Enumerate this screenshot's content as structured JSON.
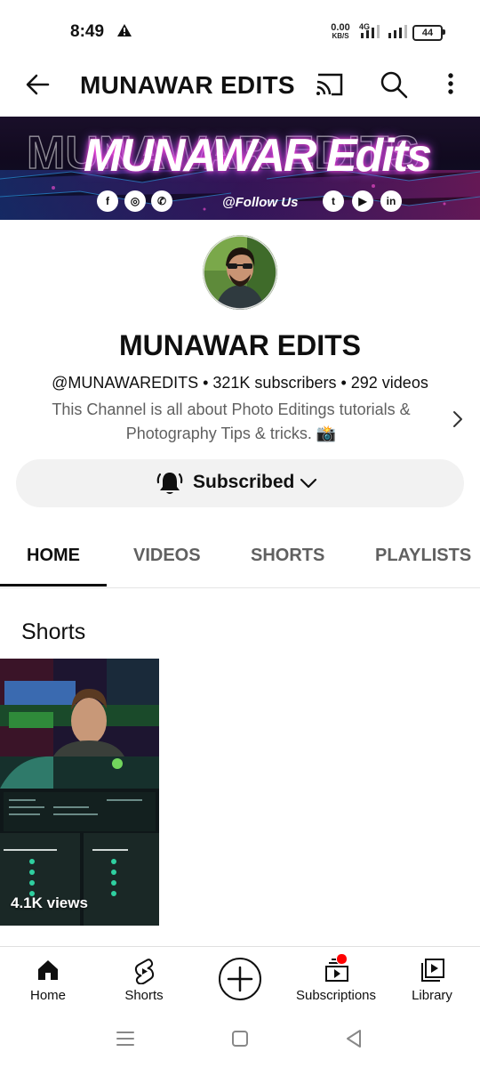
{
  "status_bar": {
    "time": "8:49",
    "net_speed_value": "0.00",
    "net_speed_unit": "KB/S",
    "network": "4G",
    "battery": "44"
  },
  "header": {
    "title": "MUNAWAR EDITS",
    "icons": [
      "back-arrow-icon",
      "cast-icon",
      "search-icon",
      "more-vert-icon"
    ]
  },
  "banner": {
    "title": "MUNAWAR Edits",
    "follow_text": "@Follow Us",
    "social_icons": [
      "facebook-icon",
      "instagram-icon",
      "whatsapp-icon",
      "twitter-icon",
      "youtube-icon",
      "linkedin-icon"
    ]
  },
  "channel": {
    "name": "MUNAWAR EDITS",
    "meta": "@MUNAWAREDITS • 321K subscribers • 292 videos",
    "description_line1": "This Channel is all about Photo Editings tutorials &",
    "description_line2": "Photography Tips & tricks. 📸"
  },
  "subscribe": {
    "label": "Subscribed"
  },
  "tabs": [
    {
      "label": "HOME",
      "active": true
    },
    {
      "label": "VIDEOS",
      "active": false
    },
    {
      "label": "SHORTS",
      "active": false
    },
    {
      "label": "PLAYLISTS",
      "active": false
    }
  ],
  "shorts": {
    "title": "Shorts",
    "items": [
      {
        "views": "4.1K views"
      }
    ]
  },
  "bottom_nav": [
    {
      "label": "Home",
      "icon": "home-icon",
      "active": true
    },
    {
      "label": "Shorts",
      "icon": "shorts-icon"
    },
    {
      "label": "",
      "icon": "create-icon"
    },
    {
      "label": "Subscriptions",
      "icon": "subscriptions-icon",
      "badge": true
    },
    {
      "label": "Library",
      "icon": "library-icon"
    }
  ],
  "colors": {
    "accent_red": "#ff0000",
    "text_primary": "#0f0f0f",
    "text_secondary": "#606060",
    "chip_bg": "#f2f2f2"
  }
}
